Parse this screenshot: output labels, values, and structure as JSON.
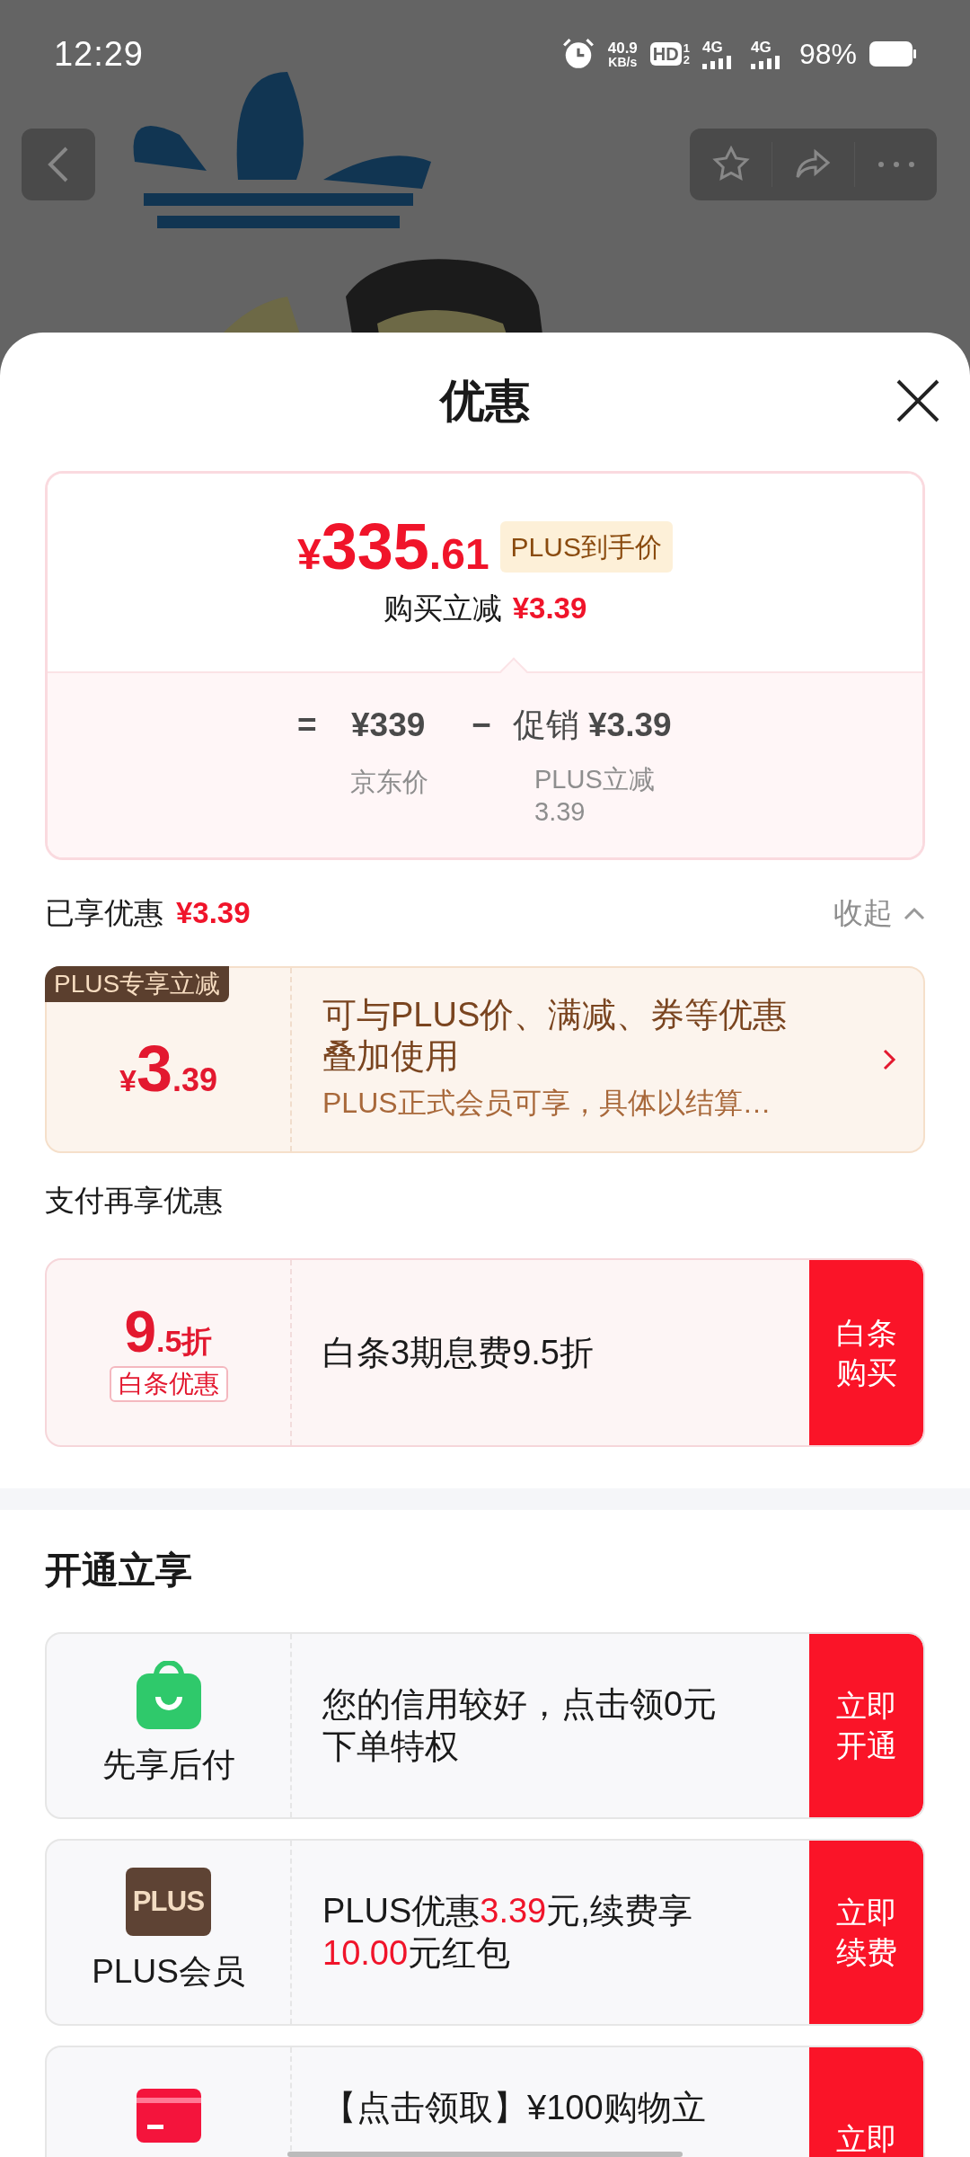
{
  "status_bar": {
    "time": "12:29",
    "speed": [
      "40.9",
      "KB/s"
    ],
    "hd": "HD",
    "hd_slots": [
      "1",
      "2"
    ],
    "networks": [
      "4G",
      "4G"
    ],
    "battery": "98%"
  },
  "sheet": {
    "title": "优惠"
  },
  "price_card": {
    "currency": "¥",
    "price_int": "335",
    "price_dec": ".61",
    "badge": "PLUS到手价",
    "saving_label": "购买立减",
    "saving": "¥3.39",
    "equals": "=",
    "base_price": "¥339",
    "minus": "−",
    "promo_label": "促销",
    "promo": "¥3.39",
    "base_caption": "京东价",
    "promo_caption": [
      "PLUS立减",
      "3.39"
    ]
  },
  "enjoyed": {
    "label": "已享优惠",
    "amount": "¥3.39",
    "toggle": "收起",
    "expanded": true
  },
  "plus_card": {
    "tag": "PLUS专享立减",
    "currency": "¥",
    "int": "3",
    "dec": ".39",
    "text": "可与PLUS价、满减、券等优惠叠加使用",
    "subtext": "PLUS正式会员可享，具体以结算…"
  },
  "pay_section": {
    "title": "支付再享优惠",
    "offers": [
      {
        "int": "9",
        "dec": ".5折",
        "tag": "白条优惠",
        "text": "白条3期息费9.5折",
        "button": "白条购买"
      }
    ]
  },
  "open_section": {
    "title": "开通立享",
    "items": [
      {
        "kind": "bag",
        "name": "先享后付",
        "segments": [
          {
            "text": "您的信用较好，点击领0元下单特权",
            "highlight": false
          }
        ],
        "button": "立即开通"
      },
      {
        "kind": "plus",
        "icon_text": "PLUS",
        "name": "PLUS会员",
        "segments": [
          {
            "text": "PLUS优惠",
            "highlight": false
          },
          {
            "text": "3.39",
            "highlight": true
          },
          {
            "text": "元,续费享",
            "highlight": false
          },
          {
            "text": "10.00",
            "highlight": true
          },
          {
            "text": "元红包",
            "highlight": false
          }
        ],
        "button": "立即续费"
      },
      {
        "kind": "card",
        "segments": [
          {
            "text": "【点击领取】¥100购物立",
            "highlight": false
          }
        ],
        "button": "立即"
      }
    ]
  }
}
